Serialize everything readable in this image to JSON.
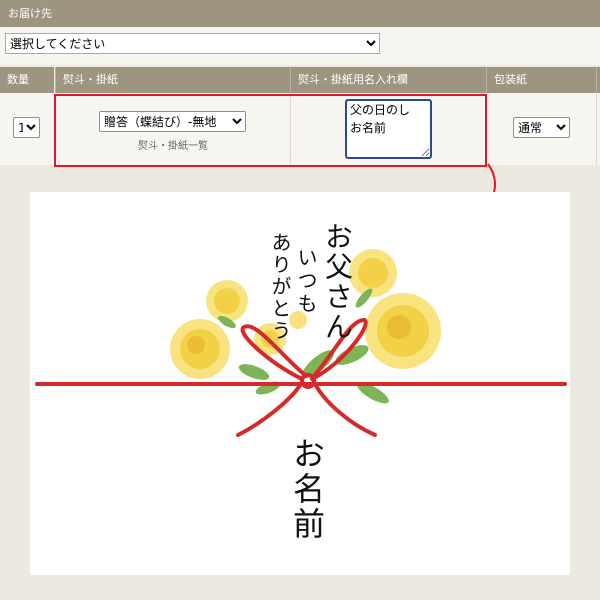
{
  "delivery": {
    "header": "お届け先",
    "select_value": "選択してください"
  },
  "table": {
    "headers": {
      "quantity": "数量",
      "noshi": "熨斗・掛紙",
      "name": "熨斗・掛紙用名入れ欄",
      "wrapping": "包装紙"
    },
    "row": {
      "quantity": "1",
      "noshi_select": "贈答（蝶結び）-無地",
      "noshi_link": "熨斗・掛紙一覧",
      "name_text": "父の日のし\nお名前",
      "wrapping_select": "通常"
    }
  },
  "preview": {
    "line1": "お父さん",
    "line2": "いつも",
    "line3": "ありがとう",
    "name": "お名前"
  },
  "colors": {
    "header_bg": "#9d9580",
    "highlight": "#e0172a",
    "ribbon": "#d62a2a",
    "flower": "#f7d34a"
  }
}
